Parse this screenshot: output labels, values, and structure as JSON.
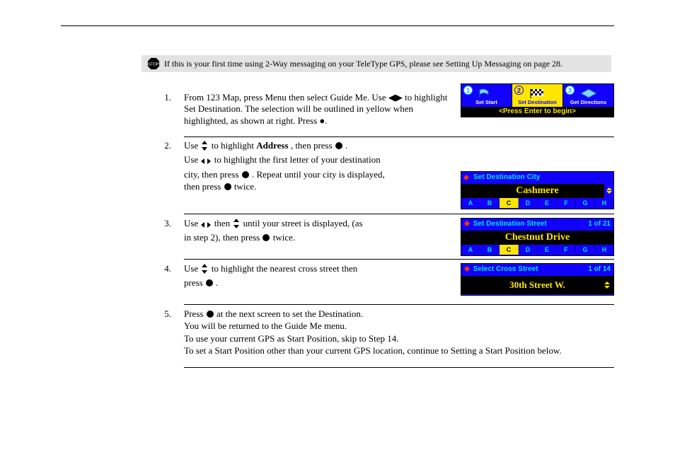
{
  "banner_text": "If this is your first time using 2-Way messaging on your TeleType GPS, please see Setting Up Messaging on page 28.",
  "stop_label": "STOP",
  "intro": {
    "num": "1.",
    "text": "From 123 Map, press Menu then select Guide Me. Use ◀▶ to highlight Set Destination. The selection will be outlined in yellow when highlighted, as shown at right. Press ●."
  },
  "guide": {
    "tabs": [
      {
        "num": "1",
        "label": "Set Start"
      },
      {
        "num": "2",
        "label": "Set Destination"
      },
      {
        "num": "3",
        "label": "Get Directions"
      }
    ],
    "footer": "<Press Enter to begin>"
  },
  "step2": {
    "num": "2.",
    "l1_a": "Use ",
    "l1_b": " to highlight ",
    "l1_c": "Address",
    "l1_d": ", then press ",
    "l1_e": ".",
    "l2_a": "Use ",
    "l2_b": " to highlight the first letter of your destination",
    "l3_a": "city, then press ",
    "l3_b": ". Repeat until your city is displayed,",
    "l4_a": "then press ",
    "l4_b": " twice."
  },
  "city_panel": {
    "title": "Set Destination City",
    "value": "Cashmere",
    "alpha": [
      "A",
      "B",
      "C",
      "D",
      "E",
      "F",
      "G",
      "H"
    ],
    "sel": "C"
  },
  "step3": {
    "num": "3.",
    "l1_a": "Use ",
    "l1_b": " then ",
    "l1_c": " until your street is displayed, (as",
    "l2_a": "in step 2), then press ",
    "l2_b": " twice."
  },
  "street_panel": {
    "title": "Set Destination Street",
    "count": "1 of 21",
    "value": "Chestnut Drive",
    "alpha": [
      "A",
      "B",
      "C",
      "D",
      "E",
      "F",
      "G",
      "H"
    ],
    "sel": "C"
  },
  "step4": {
    "num": "4.",
    "l1_a": "Use ",
    "l1_b": " to highlight the nearest cross street then",
    "l2_a": "press ",
    "l2_b": "."
  },
  "cross_panel": {
    "title": "Select Cross Street",
    "count": "1 of 14",
    "value": "30th Street W."
  },
  "step5": {
    "num": "5.",
    "l1_a": "Press ",
    "l1_b": " at the next screen to set the Destination.",
    "l2": "You will be returned to the Guide Me menu.",
    "l3": "To use your current GPS as Start Position, skip to Step 14.",
    "l4": "To set a Start Position other than your current GPS location, continue to Setting a Start Position below."
  }
}
